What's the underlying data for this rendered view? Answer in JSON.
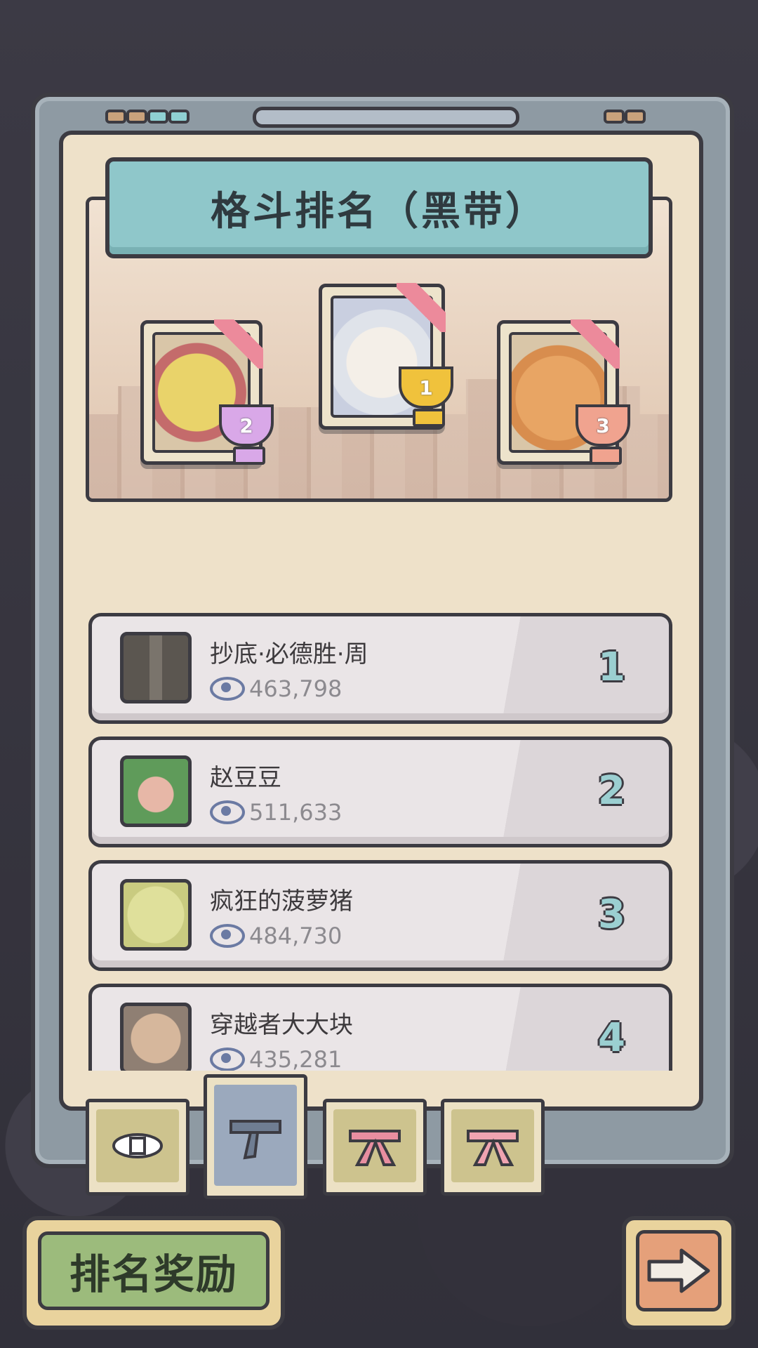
{
  "header": {
    "title": "格斗排名（黑带）"
  },
  "podium": [
    {
      "place": "2",
      "trophy_color": "#d9a8e8",
      "portrait": "fish-monster-portrait"
    },
    {
      "place": "1",
      "trophy_color": "#f0c23c",
      "portrait": "white-hair-girl-portrait"
    },
    {
      "place": "3",
      "trophy_color": "#f0a38f",
      "portrait": "orange-cat-portrait"
    }
  ],
  "rankings": [
    {
      "rank": "1",
      "name": "抄底·必德胜·周",
      "views": "463,798"
    },
    {
      "rank": "2",
      "name": "赵豆豆",
      "views": "511,633"
    },
    {
      "rank": "3",
      "name": "疯狂的菠萝猪",
      "views": "484,730"
    },
    {
      "rank": "4",
      "name": "穿越者大大块",
      "views": "435,281"
    }
  ],
  "tabs": [
    {
      "name": "white-belt",
      "active": false,
      "color": "#cdc38e"
    },
    {
      "name": "black-belt",
      "active": true,
      "color": "#9ba9bd"
    },
    {
      "name": "pink-belt",
      "active": false,
      "color": "#cdc38e"
    },
    {
      "name": "pink-belt-2",
      "active": false,
      "color": "#cdc38e"
    }
  ],
  "footer": {
    "reward_label": "排名奖励",
    "next_icon": "arrow-right-icon"
  },
  "colors": {
    "title_bar": "#8fc7ca",
    "rank_number": "#9bcfd1",
    "reward_button": "#9cbb7c",
    "next_button": "#e5a07a"
  }
}
